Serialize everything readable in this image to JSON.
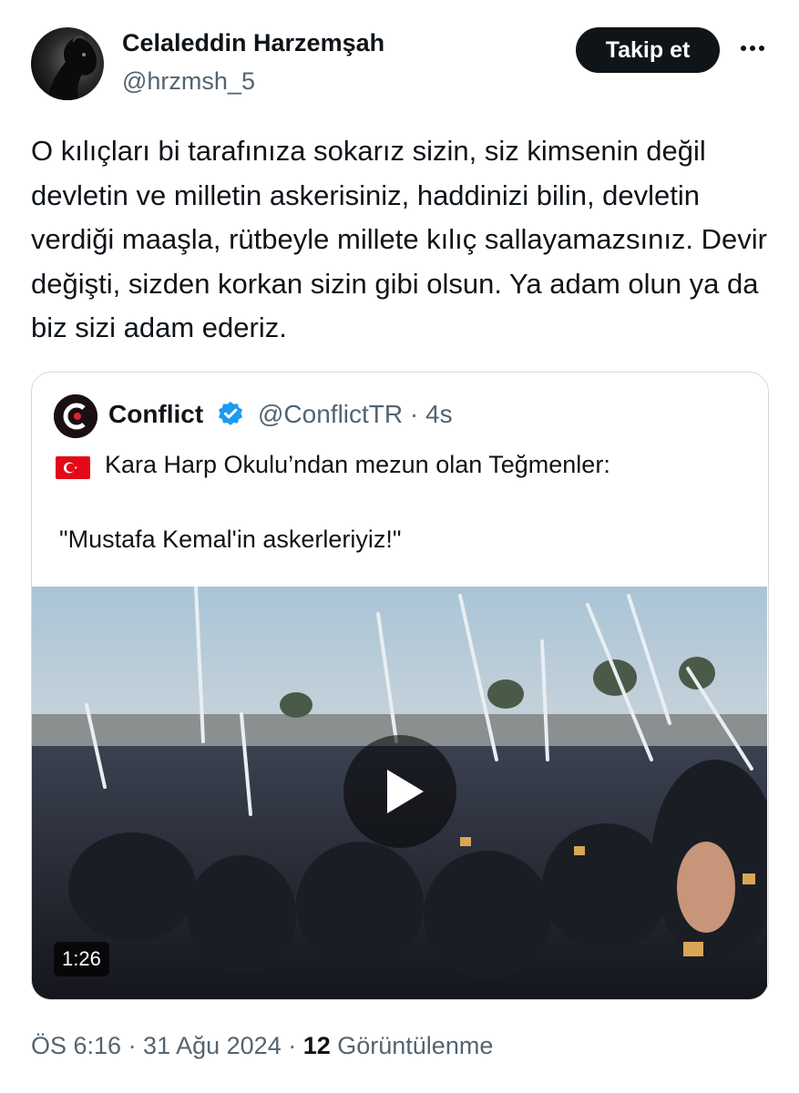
{
  "author": {
    "name": "Celaleddin Harzemşah",
    "handle": "@hrzmsh_5",
    "avatar_icon": "horse-avatar"
  },
  "follow_label": "Takip et",
  "more_icon": "more-horizontal-icon",
  "tweet_text": "O kılıçları bi tarafınıza sokarız sizin, siz kimsenin değil devletin ve milletin askerisiniz, haddinizi bilin, devletin verdiği maaşla, rütbeyle millete kılıç sallayamazsınız. Devir değişti, sizden korkan sizin gibi olsun. Ya adam olun ya da biz sizi adam ederiz.",
  "quoted": {
    "name": "Conflict",
    "verified_icon": "verified-badge-icon",
    "handle_time": "@ConflictTR · 4s",
    "flag_icon": "turkey-flag-icon",
    "line1": "Kara Harp Okulu’ndan mezun olan Teğmenler:",
    "line2": "\"Mustafa Kemal'in askerleriyiz!\"",
    "video": {
      "duration": "1:26",
      "play_icon": "play-icon"
    }
  },
  "meta": {
    "time_date": "ÖS 6:16 · 31 Ağu 2024 · ",
    "views_count": "12",
    "views_label": " Görüntülenme"
  },
  "colors": {
    "text": "#0f1419",
    "secondary": "#536471",
    "border": "#cfd9de",
    "verified": "#1d9bf0",
    "flag": "#e30a17"
  }
}
